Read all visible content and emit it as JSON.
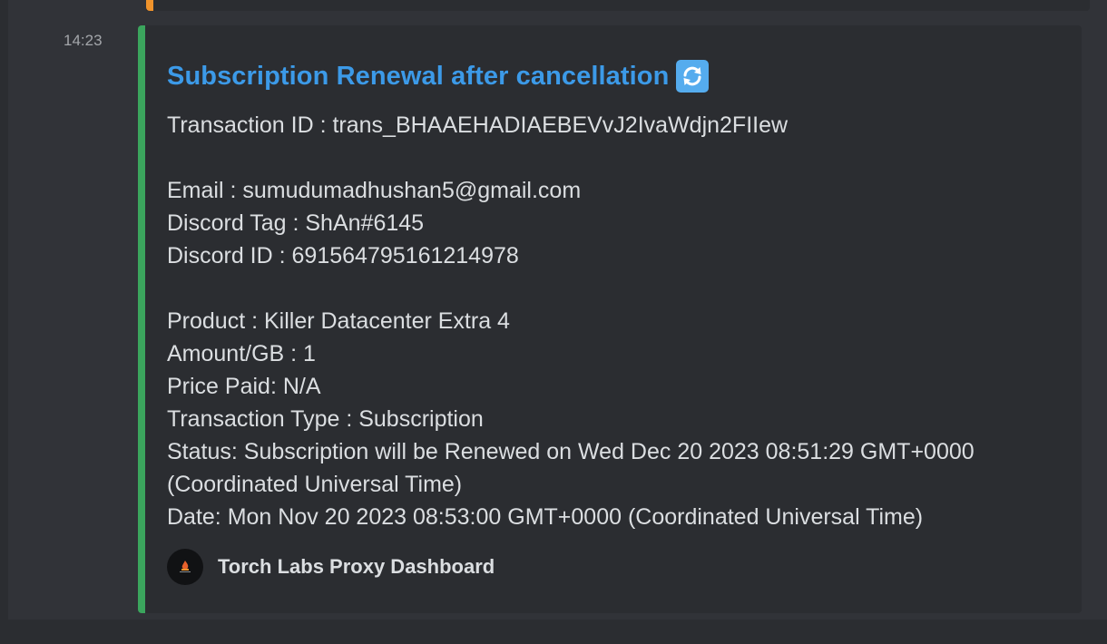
{
  "message": {
    "timestamp": "14:23"
  },
  "embed": {
    "accent_color": "#3ba55d",
    "title": "Subscription Renewal after cancellation",
    "title_icon": "arrows-counterclockwise-icon",
    "lines": {
      "transaction_id": "Transaction ID : trans_BHAAEHADIAEBEVvJ2IvaWdjn2FIIew",
      "email": "Email : sumudumadhushan5@gmail.com",
      "discord_tag": "Discord Tag : ShAn#6145",
      "discord_id": "Discord ID : 691564795161214978",
      "product": "Product : Killer Datacenter Extra 4",
      "amount": "Amount/GB : 1",
      "price_paid": "Price Paid: N/A",
      "transaction_type": "Transaction Type : Subscription",
      "status": "Status: Subscription will be Renewed on Wed Dec 20 2023 08:51:29 GMT+0000 (Coordinated Universal Time)",
      "date": "Date: Mon Nov 20 2023 08:53:00 GMT+0000 (Coordinated Universal Time)"
    },
    "footer": {
      "text": "Torch Labs Proxy Dashboard",
      "icon": "torch-labs-logo"
    }
  },
  "previous_embed": {
    "accent_color": "#f0932b"
  }
}
